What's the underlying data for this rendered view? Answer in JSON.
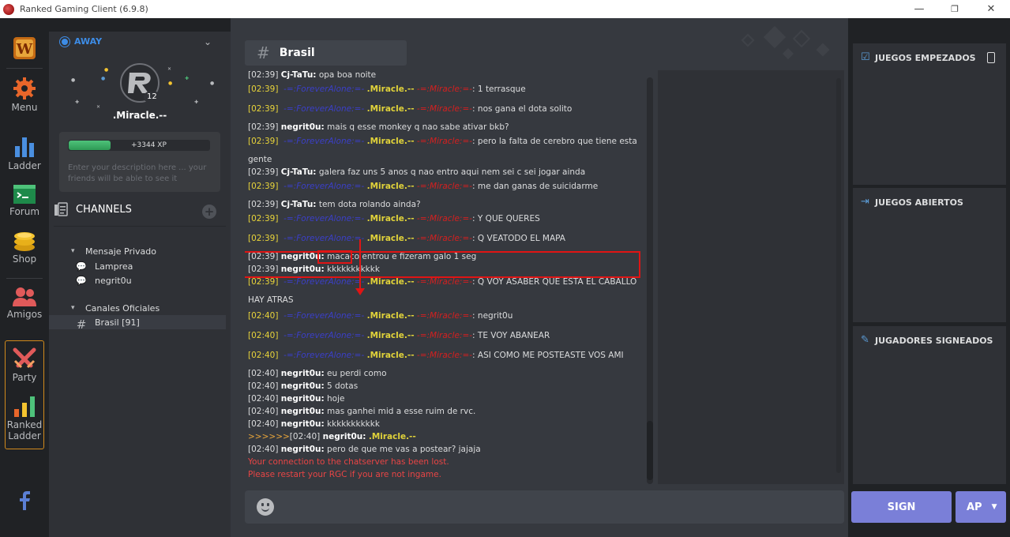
{
  "window": {
    "title": "Ranked Gaming Client (6.9.8)",
    "minimize": "—",
    "restore": "❐",
    "close": "✕"
  },
  "rail": [
    {
      "label": "",
      "icon": "game-logo-icon"
    },
    {
      "label": "Menu",
      "icon": "gear-icon"
    },
    {
      "label": "Ladder",
      "icon": "bar-chart-icon"
    },
    {
      "label": "Forum",
      "icon": "forum-icon"
    },
    {
      "label": "Shop",
      "icon": "coins-icon"
    },
    {
      "label": "Amigos",
      "icon": "friends-icon"
    },
    {
      "label": "Party",
      "icon": "crossed-swords-icon"
    },
    {
      "label": "Ranked\nLadder",
      "icon": "ranked-ladder-icon"
    },
    {
      "label": "",
      "icon": "facebook-icon"
    }
  ],
  "profile": {
    "status": "AWAY",
    "username": ".Miracle.--",
    "level": "12",
    "xp_label": "+3344 XP",
    "xp_fraction": 0.3,
    "description_placeholder": "Enter your description here ... your friends will be able to see it"
  },
  "channels": {
    "title": "CHANNELS",
    "add": "+",
    "groups": [
      {
        "label": "Mensaje Privado",
        "items": [
          {
            "label": "Lamprea"
          },
          {
            "label": "negrit0u"
          }
        ]
      },
      {
        "label": "Canales Oficiales",
        "items": [
          {
            "label": "Brasil [91]"
          }
        ]
      }
    ]
  },
  "chat": {
    "channel": "Brasil",
    "messages": [
      {
        "ts": "[02:39]",
        "user": "Cj-TaTu:",
        "text": "opa boa noite"
      },
      {
        "ts": "[02:39]",
        "prefix": "-=:ForeverAlone:=-",
        "user": ".Miracle.--",
        "suffix": "-=:Miracle:=-",
        "text": ": 1 terrasque"
      },
      {
        "ts": "[02:39]",
        "prefix": "-=:ForeverAlone:=-",
        "user": ".Miracle.--",
        "suffix": "-=:Miracle:=-",
        "text": ": nos gana el dota solito"
      },
      {
        "ts": "[02:39]",
        "user": "negrit0u:",
        "text": "mais q esse monkey q nao sabe ativar bkb?"
      },
      {
        "ts": "[02:39]",
        "prefix": "-=:ForeverAlone:=-",
        "user": ".Miracle.--",
        "suffix": "-=:Miracle:=-",
        "text": ": pero la falta de cerebro que tiene esta gente"
      },
      {
        "ts": "[02:39]",
        "user": "Cj-TaTu:",
        "text": "galera faz uns 5 anos q nao entro aqui nem sei c sei jogar ainda"
      },
      {
        "ts": "[02:39]",
        "prefix": "-=:ForeverAlone:=-",
        "user": ".Miracle.--",
        "suffix": "-=:Miracle:=-",
        "text": ": me dan ganas de suicidarme"
      },
      {
        "ts": "[02:39]",
        "user": "Cj-TaTu:",
        "text": "tem dota rolando ainda?"
      },
      {
        "ts": "[02:39]",
        "prefix": "-=:ForeverAlone:=-",
        "user": ".Miracle.--",
        "suffix": "-=:Miracle:=-",
        "text": ": Y QUE QUERES"
      },
      {
        "ts": "[02:39]",
        "prefix": "-=:ForeverAlone:=-",
        "user": ".Miracle.--",
        "suffix": "-=:Miracle:=-",
        "text": ": Q VEATODO EL MAPA"
      },
      {
        "ts": "[02:39]",
        "user": "negrit0u:",
        "text": "macaco entrou e fizeram galo 1 seg"
      },
      {
        "ts": "[02:39]",
        "user": "negrit0u:",
        "text": "kkkkkkkkkkk"
      },
      {
        "ts": "[02:39]",
        "prefix": "-=:ForeverAlone:=-",
        "user": ".Miracle.--",
        "suffix": "-=:Miracle:=-",
        "text": ": Q VOY ASABER QUE ESTA EL CABALLO HAY ATRAS"
      },
      {
        "ts": "[02:40]",
        "prefix": "-=:ForeverAlone:=-",
        "user": ".Miracle.--",
        "suffix": "-=:Miracle:=-",
        "text": ": negrit0u"
      },
      {
        "ts": "[02:40]",
        "prefix": "-=:ForeverAlone:=-",
        "user": ".Miracle.--",
        "suffix": "-=:Miracle:=-",
        "text": ": TE VOY ABANEAR"
      },
      {
        "ts": "[02:40]",
        "prefix": "-=:ForeverAlone:=-",
        "user": ".Miracle.--",
        "suffix": "-=:Miracle:=-",
        "text": ": ASI COMO ME POSTEASTE VOS AMI"
      },
      {
        "ts": "[02:40]",
        "user": "negrit0u:",
        "text": "eu perdi como"
      },
      {
        "ts": "[02:40]",
        "user": "negrit0u:",
        "text": "5 dotas"
      },
      {
        "ts": "[02:40]",
        "user": "negrit0u:",
        "text": "hoje"
      },
      {
        "ts": "[02:40]",
        "user": "negrit0u:",
        "text": "mas ganhei mid a esse ruim de rvc."
      },
      {
        "ts": "[02:40]",
        "user": "negrit0u:",
        "text": "kkkkkkkkkkk"
      },
      {
        "fwd": ">>>>>>",
        "ts": "[02:40]",
        "user": "negrit0u:",
        "text": ".Miracle.--"
      },
      {
        "ts": "[02:40]",
        "user": "negrit0u:",
        "text": "pero de que me vas a postear? jajaja"
      },
      {
        "error": "Your connection to the chatserver has been lost."
      },
      {
        "error": "Please restart your RGC if you are not ingame."
      }
    ],
    "highlight_word": "macaco"
  },
  "right_panel": {
    "sections": [
      {
        "title": "JUEGOS EMPEZADOS",
        "icon": "checkbox-icon"
      },
      {
        "title": "JUEGOS ABIERTOS",
        "icon": "sign-in-icon"
      },
      {
        "title": "JUGADORES SIGNEADOS",
        "icon": "edit-icon"
      }
    ],
    "sign_label": "SIGN",
    "ap_label": "AP"
  },
  "colors": {
    "accent": "#7a7fd8",
    "away": "#3d8ce6",
    "highlight": "#e01414"
  }
}
